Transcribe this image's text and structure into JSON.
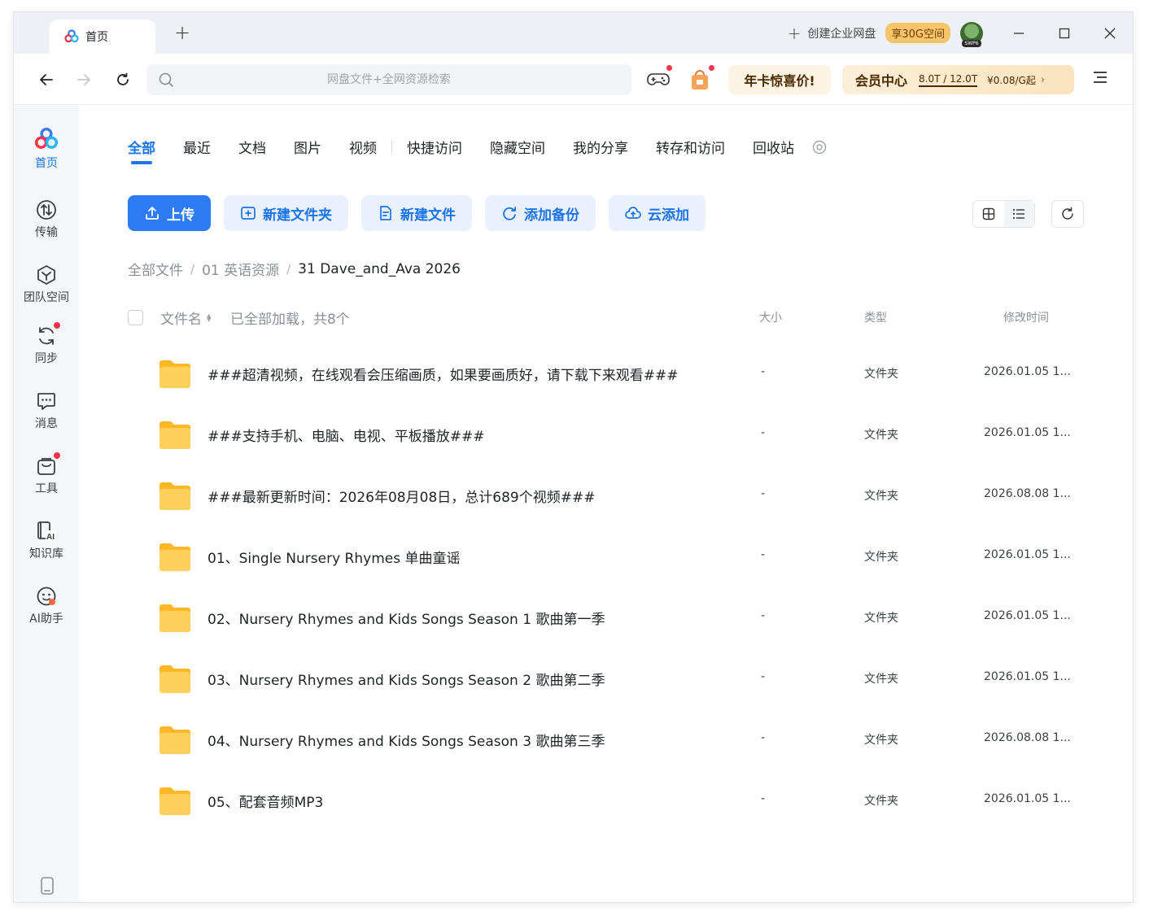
{
  "tab": {
    "title": "首页"
  },
  "titlebar": {
    "create_enterprise": "创建企业网盘",
    "badge": "享30G空间"
  },
  "toolbar": {
    "search_placeholder": "网盘文件+全网资源检索",
    "promo": "年卡惊喜价!",
    "vip_label": "会员中心",
    "vip_storage": "8.0T / 12.0T",
    "vip_price": "¥0.08/G起"
  },
  "sidebar": {
    "items": [
      {
        "label": "首页",
        "icon": "home-logo-icon"
      },
      {
        "label": "传输",
        "icon": "transfer-icon"
      },
      {
        "label": "团队空间",
        "icon": "team-icon"
      },
      {
        "label": "同步",
        "icon": "sync-icon"
      },
      {
        "label": "消息",
        "icon": "message-icon"
      },
      {
        "label": "工具",
        "icon": "tools-icon"
      },
      {
        "label": "知识库",
        "icon": "knowledge-icon"
      },
      {
        "label": "AI助手",
        "icon": "ai-assistant-icon"
      }
    ]
  },
  "categories": [
    "全部",
    "最近",
    "文档",
    "图片",
    "视频",
    "快捷访问",
    "隐藏空间",
    "我的分享",
    "转存和访问",
    "回收站"
  ],
  "actions": {
    "upload": "上传",
    "new_folder": "新建文件夹",
    "new_file": "新建文件",
    "add_backup": "添加备份",
    "cloud_add": "云添加"
  },
  "breadcrumb": [
    "全部文件",
    "01 英语资源",
    "31 Dave_and_Ava 2026"
  ],
  "table": {
    "col_name": "文件名",
    "loaded_text": "已全部加载，共8个",
    "col_size": "大小",
    "col_type": "类型",
    "col_time": "修改时间",
    "rows": [
      {
        "name": "###超清视频，在线观看会压缩画质，如果要画质好，请下载下来观看###",
        "size": "-",
        "type": "文件夹",
        "time": "2026.01.05 1..."
      },
      {
        "name": "###支持手机、电脑、电视、平板播放###",
        "size": "-",
        "type": "文件夹",
        "time": "2026.01.05 1..."
      },
      {
        "name": "###最新更新时间：2026年08月08日，总计689个视频###",
        "size": "-",
        "type": "文件夹",
        "time": "2026.08.08 1..."
      },
      {
        "name": "01、Single Nursery Rhymes 单曲童谣",
        "size": "-",
        "type": "文件夹",
        "time": "2026.01.05 1..."
      },
      {
        "name": "02、Nursery Rhymes and Kids Songs Season 1 歌曲第一季",
        "size": "-",
        "type": "文件夹",
        "time": "2026.01.05 1..."
      },
      {
        "name": "03、Nursery Rhymes and Kids Songs Season 2 歌曲第二季",
        "size": "-",
        "type": "文件夹",
        "time": "2026.01.05 1..."
      },
      {
        "name": "04、Nursery Rhymes and Kids Songs Season 3 歌曲第三季",
        "size": "-",
        "type": "文件夹",
        "time": "2026.08.08 1..."
      },
      {
        "name": "05、配套音频MP3",
        "size": "-",
        "type": "文件夹",
        "time": "2026.01.05 1..."
      }
    ]
  },
  "colors": {
    "accent": "#2f7bf5",
    "folder": "#ffc83d",
    "red_dot": "#f5344a"
  }
}
